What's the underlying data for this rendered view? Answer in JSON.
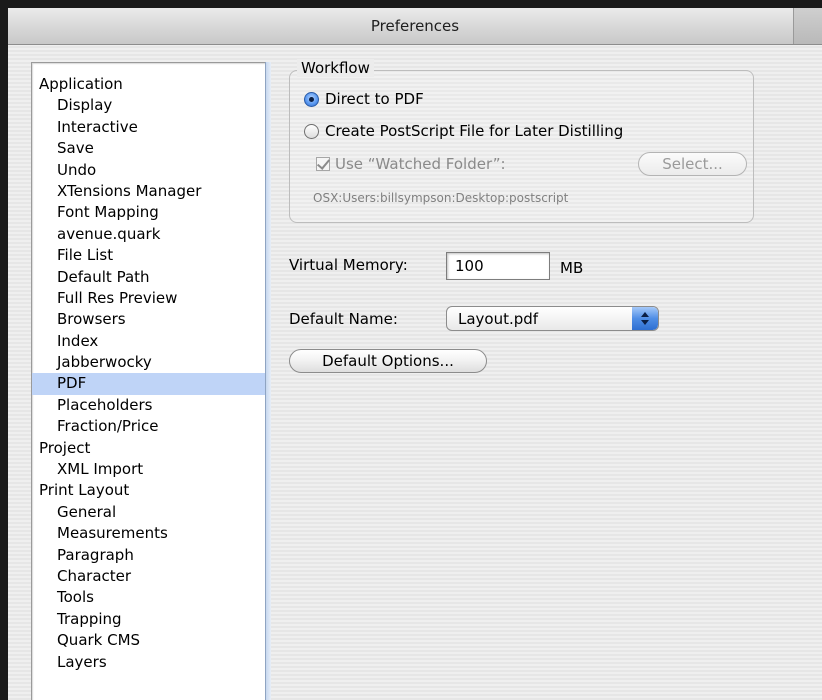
{
  "window": {
    "title": "Preferences"
  },
  "sidebar": {
    "items": [
      {
        "label": "Application",
        "level": 0
      },
      {
        "label": "Display",
        "level": 1
      },
      {
        "label": "Interactive",
        "level": 1
      },
      {
        "label": "Save",
        "level": 1
      },
      {
        "label": "Undo",
        "level": 1
      },
      {
        "label": "XTensions Manager",
        "level": 1
      },
      {
        "label": "Font Mapping",
        "level": 1
      },
      {
        "label": "avenue.quark",
        "level": 1
      },
      {
        "label": "File List",
        "level": 1
      },
      {
        "label": "Default Path",
        "level": 1
      },
      {
        "label": "Full Res Preview",
        "level": 1
      },
      {
        "label": "Browsers",
        "level": 1
      },
      {
        "label": "Index",
        "level": 1
      },
      {
        "label": "Jabberwocky",
        "level": 1
      },
      {
        "label": "PDF",
        "level": 1,
        "selected": true
      },
      {
        "label": "Placeholders",
        "level": 1
      },
      {
        "label": "Fraction/Price",
        "level": 1
      },
      {
        "label": "Project",
        "level": 0
      },
      {
        "label": "XML Import",
        "level": 1
      },
      {
        "label": "Print Layout",
        "level": 0
      },
      {
        "label": "General",
        "level": 1
      },
      {
        "label": "Measurements",
        "level": 1
      },
      {
        "label": "Paragraph",
        "level": 1
      },
      {
        "label": "Character",
        "level": 1
      },
      {
        "label": "Tools",
        "level": 1
      },
      {
        "label": "Trapping",
        "level": 1
      },
      {
        "label": "Quark CMS",
        "level": 1
      },
      {
        "label": "Layers",
        "level": 1
      }
    ]
  },
  "workflow": {
    "title": "Workflow",
    "direct_to_pdf": {
      "label": "Direct to PDF",
      "selected": true
    },
    "postscript": {
      "label": "Create PostScript File for Later Distilling",
      "selected": false
    },
    "watched_folder": {
      "label": "Use “Watched Folder”:",
      "checked": true,
      "enabled": false
    },
    "select_button": "Select...",
    "path": "OSX:Users:billsympson:Desktop:postscript"
  },
  "virtual_memory": {
    "label": "Virtual Memory:",
    "value": "100",
    "unit": "MB"
  },
  "default_name": {
    "label": "Default Name:",
    "selected": "Layout.pdf"
  },
  "default_options_button": "Default Options...",
  "colors": {
    "selection": "#bfd4f7",
    "accent": "#4f8ee6"
  }
}
